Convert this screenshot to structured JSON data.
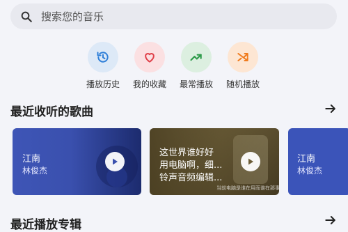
{
  "search": {
    "placeholder": "搜索您的音乐"
  },
  "quick_actions": [
    {
      "label": "播放历史",
      "icon": "history-icon",
      "bg": "#dde9f7",
      "color": "#2f7fd8"
    },
    {
      "label": "我的收藏",
      "icon": "heart-icon",
      "bg": "#fbe0e2",
      "color": "#e0404a"
    },
    {
      "label": "最常播放",
      "icon": "trending-up-icon",
      "bg": "#dcefe0",
      "color": "#2e9b4a"
    },
    {
      "label": "随机播放",
      "icon": "shuffle-icon",
      "bg": "#fde6d3",
      "color": "#f07b1d"
    }
  ],
  "recent_songs": {
    "title": "最近收听的歌曲",
    "cards": [
      {
        "title": "江南",
        "artist": "林俊杰"
      },
      {
        "line1": "这世界谁好好",
        "line2": "用电脑啊，细...",
        "line3": "铃声音频编辑...",
        "watermark": "当前电脑是谁在用而谁在那事情啊"
      },
      {
        "title": "江南",
        "artist": "林俊杰"
      }
    ]
  },
  "recent_albums": {
    "title": "最近播放专辑"
  }
}
